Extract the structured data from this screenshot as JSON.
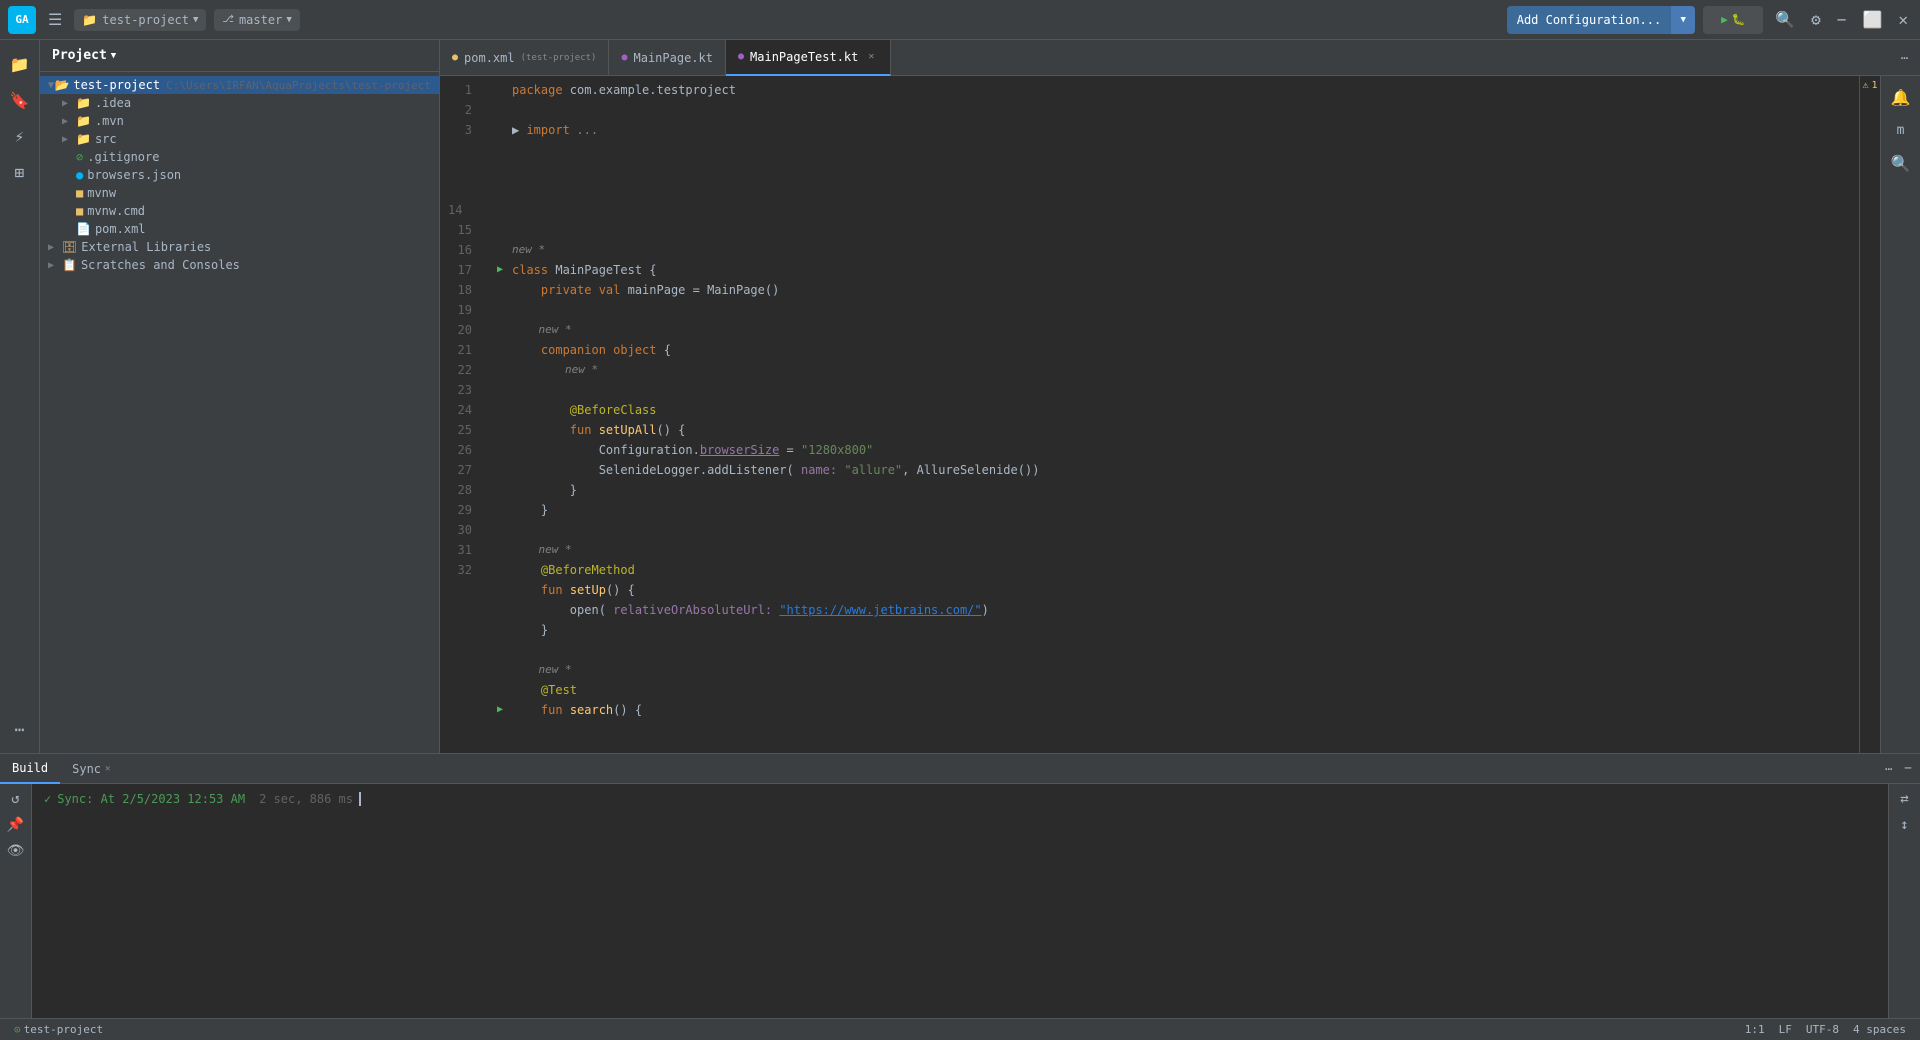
{
  "toolbar": {
    "logo": "GA",
    "project_name": "test-project",
    "branch": "master",
    "add_config_label": "Add Configuration...",
    "run_icon": "▶",
    "search_icon": "🔍",
    "settings_icon": "⚙",
    "minimize_icon": "−",
    "maximize_icon": "⬜",
    "close_icon": "✕"
  },
  "sidebar": {
    "header": "Project",
    "root": "test-project",
    "root_path": "C:\\Users\\IRFAN\\AquaProjects\\test-project",
    "items": [
      {
        "indent": 1,
        "type": "folder",
        "name": ".idea",
        "expanded": false
      },
      {
        "indent": 1,
        "type": "folder",
        "name": ".mvn",
        "expanded": false
      },
      {
        "indent": 1,
        "type": "folder",
        "name": "src",
        "expanded": false
      },
      {
        "indent": 1,
        "type": "gitignore",
        "name": ".gitignore"
      },
      {
        "indent": 1,
        "type": "json",
        "name": "browsers.json"
      },
      {
        "indent": 1,
        "type": "cmd",
        "name": "mvnw"
      },
      {
        "indent": 1,
        "type": "cmd",
        "name": "mvnw.cmd"
      },
      {
        "indent": 1,
        "type": "xml",
        "name": "pom.xml"
      }
    ],
    "external_libraries": "External Libraries",
    "scratches": "Scratches and Consoles"
  },
  "tabs": [
    {
      "name": "pom.xml",
      "project": "test-project",
      "active": false,
      "closeable": false,
      "icon": "xml"
    },
    {
      "name": "MainPage.kt",
      "active": false,
      "closeable": false,
      "icon": "kt"
    },
    {
      "name": "MainPageTest.kt",
      "active": true,
      "closeable": true,
      "icon": "kt"
    }
  ],
  "editor": {
    "warning_count": "1",
    "lines": [
      {
        "num": 1,
        "run": false,
        "code": "package_com.example.testproject"
      },
      {
        "num": 2,
        "run": false,
        "code": ""
      },
      {
        "num": 3,
        "run": false,
        "code": "import_..."
      },
      {
        "num": 14,
        "run": false,
        "code": ""
      },
      {
        "num": 15,
        "run": true,
        "code": "class_MainPageTest_{"
      },
      {
        "num": 16,
        "run": false,
        "code": "    private_val_mainPage_=_MainPage()"
      },
      {
        "num": 17,
        "run": false,
        "code": ""
      },
      {
        "num": 18,
        "run": false,
        "code": "    companion_object_{"
      },
      {
        "num": 19,
        "run": false,
        "code": ""
      },
      {
        "num": 20,
        "run": false,
        "code": "        @BeforeClass"
      },
      {
        "num": 21,
        "run": false,
        "code": "        fun_setUpAll()_{"
      },
      {
        "num": 22,
        "run": false,
        "code": "            Configuration.browserSize_=_\"1280x800\""
      },
      {
        "num": 23,
        "run": false,
        "code": "            SelenideLogger.addListener(_name:_\"allure\",_AllureSelenide())"
      },
      {
        "num": 24,
        "run": false,
        "code": "        }"
      },
      {
        "num": 25,
        "run": false,
        "code": ""
      },
      {
        "num": 26,
        "run": false,
        "code": "    @BeforeMethod"
      },
      {
        "num": 27,
        "run": false,
        "code": "    fun_setUp()_{"
      },
      {
        "num": 28,
        "run": false,
        "code": "        open(_relativeOrAbsoluteUrl:_\"https://www.jetbrains.com/\")"
      },
      {
        "num": 29,
        "run": false,
        "code": "    }"
      },
      {
        "num": 30,
        "run": false,
        "code": ""
      },
      {
        "num": 31,
        "run": false,
        "code": "@Test"
      },
      {
        "num": 32,
        "run": true,
        "code": "fun_search()_{"
      }
    ]
  },
  "bottom_panel": {
    "tabs": [
      {
        "name": "Build",
        "active": true,
        "closeable": false
      },
      {
        "name": "Sync",
        "active": false,
        "closeable": true
      }
    ],
    "sync_message": "Sync: At 2/5/2023 12:53 AM",
    "sync_time": "2 sec, 886 ms"
  },
  "status_bar": {
    "project": "test-project",
    "position": "1:1",
    "line_sep": "LF",
    "encoding": "UTF-8",
    "indent": "4 spaces"
  }
}
